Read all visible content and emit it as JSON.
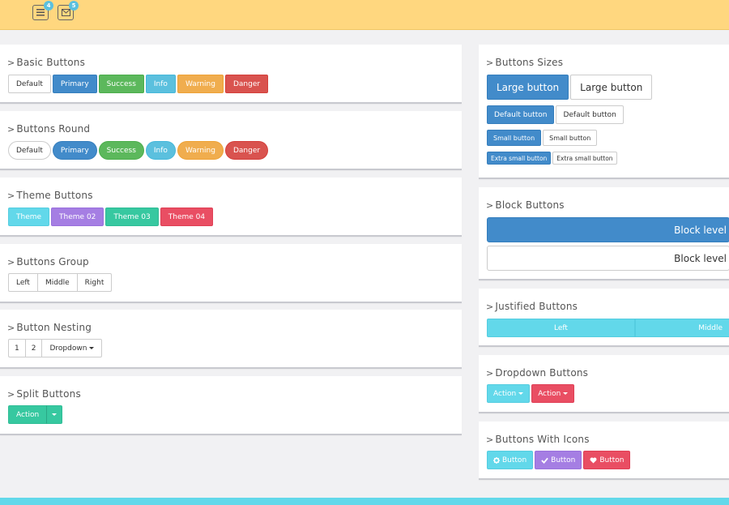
{
  "topbar": {
    "items": [
      {
        "icon": "list-icon",
        "badge": "4"
      },
      {
        "icon": "mail-icon",
        "badge": "5"
      }
    ]
  },
  "left": {
    "basic": {
      "title": "Basic Buttons",
      "buttons": [
        "Default",
        "Primary",
        "Success",
        "Info",
        "Warning",
        "Danger"
      ]
    },
    "round": {
      "title": "Buttons Round",
      "buttons": [
        "Default",
        "Primary",
        "Success",
        "Info",
        "Warning",
        "Danger"
      ]
    },
    "theme": {
      "title": "Theme Buttons",
      "buttons": [
        "Theme",
        "Theme 02",
        "Theme 03",
        "Theme 04"
      ]
    },
    "group": {
      "title": "Buttons Group",
      "buttons": [
        "Left",
        "Middle",
        "Right"
      ]
    },
    "nesting": {
      "title": "Button Nesting",
      "buttons": [
        "1",
        "2",
        "Dropdown"
      ]
    },
    "split": {
      "title": "Split Buttons",
      "action": "Action"
    }
  },
  "right": {
    "sizes": {
      "title": "Buttons Sizes",
      "large": [
        "Large button",
        "Large button"
      ],
      "default": [
        "Default button",
        "Default button"
      ],
      "small": [
        "Small button",
        "Small button"
      ],
      "xsmall": [
        "Extra small button",
        "Extra small button"
      ]
    },
    "block": {
      "title": "Block Buttons",
      "buttons": [
        "Block level bu",
        "Block level bu"
      ]
    },
    "justified": {
      "title": "Justified Buttons",
      "buttons": [
        "Left",
        "Middle"
      ]
    },
    "dropdown": {
      "title": "Dropdown Buttons",
      "buttons": [
        "Action",
        "Action"
      ]
    },
    "icons": {
      "title": "Buttons With Icons",
      "buttons": [
        {
          "icon": "gear-icon",
          "label": "Button"
        },
        {
          "icon": "check-icon",
          "label": "Button"
        },
        {
          "icon": "heart-icon",
          "label": "Button"
        }
      ]
    }
  },
  "colors": {
    "topbar": "#ffd77f",
    "bottombar": "#62d8ea",
    "primary": "#428bca",
    "success": "#5cb85c",
    "info": "#5bc0de",
    "warning": "#f0ad4e",
    "danger": "#d9534f",
    "theme1": "#62d8ea",
    "theme2": "#a57ee3",
    "theme3": "#37c8a0",
    "theme4": "#e94e63"
  }
}
